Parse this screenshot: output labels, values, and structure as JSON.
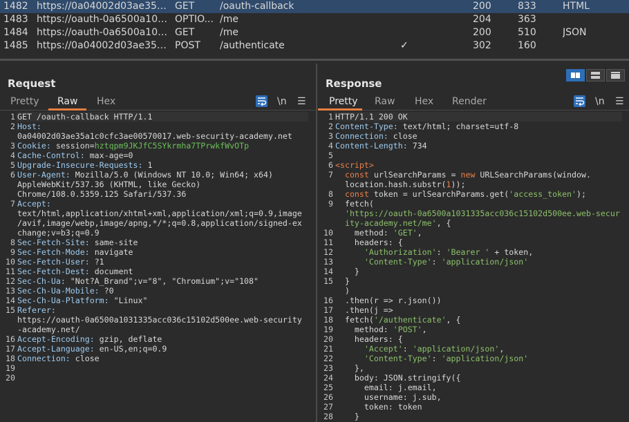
{
  "history": {
    "rows": [
      {
        "id": "1482",
        "host": "https://0a04002d03ae35a1c...",
        "method": "GET",
        "url": "/oauth-callback",
        "params": "",
        "status": "200",
        "length": "833",
        "mime": "HTML",
        "selected": true
      },
      {
        "id": "1483",
        "host": "https://oauth-0a6500a1031...",
        "method": "OPTIO...",
        "url": "/me",
        "params": "",
        "status": "204",
        "length": "363",
        "mime": "",
        "selected": false
      },
      {
        "id": "1484",
        "host": "https://oauth-0a6500a1031...",
        "method": "GET",
        "url": "/me",
        "params": "",
        "status": "200",
        "length": "510",
        "mime": "JSON",
        "selected": false
      },
      {
        "id": "1485",
        "host": "https://0a04002d03ae35a1c...",
        "method": "POST",
        "url": "/authenticate",
        "params": "✓",
        "status": "302",
        "length": "160",
        "mime": "",
        "selected": false
      }
    ]
  },
  "request": {
    "title": "Request",
    "tabs": [
      "Pretty",
      "Raw",
      "Hex"
    ],
    "active_tab": "Raw",
    "newline_label": "\\n",
    "lines": [
      {
        "n": "1",
        "segs": [
          {
            "t": "GET /oauth-callback HTTP/1.1",
            "c": ""
          }
        ]
      },
      {
        "n": "2",
        "segs": [
          {
            "t": "Host:",
            "c": "k"
          }
        ]
      },
      {
        "n": "",
        "segs": [
          {
            "t": "0a04002d03ae35a1c0cfc3ae00570017.web-security-academy.net",
            "c": ""
          }
        ]
      },
      {
        "n": "3",
        "segs": [
          {
            "t": "Cookie: ",
            "c": "k"
          },
          {
            "t": "session",
            "c": ""
          },
          {
            "t": "=",
            "c": ""
          },
          {
            "t": "hztqpm9JKJfC5SYkrmha7TPrwkfWvOTp",
            "c": "cookie"
          }
        ]
      },
      {
        "n": "4",
        "segs": [
          {
            "t": "Cache-Control: ",
            "c": "k"
          },
          {
            "t": "max-age=0",
            "c": ""
          }
        ]
      },
      {
        "n": "5",
        "segs": [
          {
            "t": "Upgrade-Insecure-Requests: ",
            "c": "k"
          },
          {
            "t": "1",
            "c": ""
          }
        ]
      },
      {
        "n": "6",
        "segs": [
          {
            "t": "User-Agent: ",
            "c": "k"
          },
          {
            "t": "Mozilla/5.0 (Windows NT 10.0; Win64; x64)",
            "c": ""
          }
        ]
      },
      {
        "n": "",
        "segs": [
          {
            "t": "AppleWebKit/537.36 (KHTML, like Gecko)",
            "c": ""
          }
        ]
      },
      {
        "n": "",
        "segs": [
          {
            "t": "Chrome/108.0.5359.125 Safari/537.36",
            "c": ""
          }
        ]
      },
      {
        "n": "7",
        "segs": [
          {
            "t": "Accept:",
            "c": "k"
          }
        ]
      },
      {
        "n": "",
        "segs": [
          {
            "t": "text/html,application/xhtml+xml,application/xml;q=0.9,image",
            "c": ""
          }
        ]
      },
      {
        "n": "",
        "segs": [
          {
            "t": "/avif,image/webp,image/apng,*/*;q=0.8,application/signed-ex",
            "c": ""
          }
        ]
      },
      {
        "n": "",
        "segs": [
          {
            "t": "change;v=b3;q=0.9",
            "c": ""
          }
        ]
      },
      {
        "n": "8",
        "segs": [
          {
            "t": "Sec-Fetch-Site: ",
            "c": "k"
          },
          {
            "t": "same-site",
            "c": ""
          }
        ]
      },
      {
        "n": "9",
        "segs": [
          {
            "t": "Sec-Fetch-Mode: ",
            "c": "k"
          },
          {
            "t": "navigate",
            "c": ""
          }
        ]
      },
      {
        "n": "10",
        "segs": [
          {
            "t": "Sec-Fetch-User: ",
            "c": "k"
          },
          {
            "t": "?1",
            "c": ""
          }
        ]
      },
      {
        "n": "11",
        "segs": [
          {
            "t": "Sec-Fetch-Dest: ",
            "c": "k"
          },
          {
            "t": "document",
            "c": ""
          }
        ]
      },
      {
        "n": "12",
        "segs": [
          {
            "t": "Sec-Ch-Ua: ",
            "c": "k"
          },
          {
            "t": "\"Not?A_Brand\";v=\"8\", \"Chromium\";v=\"108\"",
            "c": ""
          }
        ]
      },
      {
        "n": "13",
        "segs": [
          {
            "t": "Sec-Ch-Ua-Mobile: ",
            "c": "k"
          },
          {
            "t": "?0",
            "c": ""
          }
        ]
      },
      {
        "n": "14",
        "segs": [
          {
            "t": "Sec-Ch-Ua-Platform: ",
            "c": "k"
          },
          {
            "t": "\"Linux\"",
            "c": ""
          }
        ]
      },
      {
        "n": "15",
        "segs": [
          {
            "t": "Referer:",
            "c": "k"
          }
        ]
      },
      {
        "n": "",
        "segs": [
          {
            "t": "https://oauth-0a6500a1031335acc036c15102d500ee.web-security",
            "c": ""
          }
        ]
      },
      {
        "n": "",
        "segs": [
          {
            "t": "-academy.net/",
            "c": ""
          }
        ]
      },
      {
        "n": "16",
        "segs": [
          {
            "t": "Accept-Encoding: ",
            "c": "k"
          },
          {
            "t": "gzip, deflate",
            "c": ""
          }
        ]
      },
      {
        "n": "17",
        "segs": [
          {
            "t": "Accept-Language: ",
            "c": "k"
          },
          {
            "t": "en-US,en;q=0.9",
            "c": ""
          }
        ]
      },
      {
        "n": "18",
        "segs": [
          {
            "t": "Connection: ",
            "c": "k"
          },
          {
            "t": "close",
            "c": ""
          }
        ]
      },
      {
        "n": "19",
        "segs": []
      },
      {
        "n": "20",
        "segs": []
      }
    ]
  },
  "response": {
    "title": "Response",
    "tabs": [
      "Pretty",
      "Raw",
      "Hex",
      "Render"
    ],
    "active_tab": "Pretty",
    "newline_label": "\\n",
    "lines": [
      {
        "n": "1",
        "segs": [
          {
            "t": "HTTP/1.1 200 OK",
            "c": ""
          }
        ]
      },
      {
        "n": "2",
        "segs": [
          {
            "t": "Content-Type: ",
            "c": "k"
          },
          {
            "t": "text/html; charset=utf-8",
            "c": ""
          }
        ]
      },
      {
        "n": "3",
        "segs": [
          {
            "t": "Connection: ",
            "c": "k"
          },
          {
            "t": "close",
            "c": ""
          }
        ]
      },
      {
        "n": "4",
        "segs": [
          {
            "t": "Content-Length: ",
            "c": "k"
          },
          {
            "t": "734",
            "c": ""
          }
        ]
      },
      {
        "n": "5",
        "segs": []
      },
      {
        "n": "6",
        "segs": [
          {
            "t": "<script>",
            "c": "kw"
          }
        ]
      },
      {
        "n": "7",
        "segs": [
          {
            "t": "  const ",
            "c": "kw"
          },
          {
            "t": "urlSearchParams = ",
            "c": ""
          },
          {
            "t": "new ",
            "c": "kw"
          },
          {
            "t": "URLSearchParams(window.",
            "c": ""
          }
        ]
      },
      {
        "n": "",
        "segs": [
          {
            "t": "  location.hash.substr(",
            "c": ""
          },
          {
            "t": "1",
            "c": "kw"
          },
          {
            "t": "));",
            "c": ""
          }
        ]
      },
      {
        "n": "8",
        "segs": [
          {
            "t": "  const ",
            "c": "kw"
          },
          {
            "t": "token = urlSearchParams.get(",
            "c": ""
          },
          {
            "t": "'access_token'",
            "c": "str"
          },
          {
            "t": ");",
            "c": ""
          }
        ]
      },
      {
        "n": "9",
        "segs": [
          {
            "t": "  fetch(",
            "c": ""
          }
        ]
      },
      {
        "n": "",
        "segs": [
          {
            "t": "  'https://oauth-0a6500a1031335acc036c15102d500ee.web-secur",
            "c": "str"
          }
        ]
      },
      {
        "n": "",
        "segs": [
          {
            "t": "  ity-academy.net/me'",
            "c": "str"
          },
          {
            "t": ", {",
            "c": ""
          }
        ]
      },
      {
        "n": "10",
        "segs": [
          {
            "t": "    method: ",
            "c": ""
          },
          {
            "t": "'GET'",
            "c": "str"
          },
          {
            "t": ",",
            "c": ""
          }
        ]
      },
      {
        "n": "11",
        "segs": [
          {
            "t": "    headers: {",
            "c": ""
          }
        ]
      },
      {
        "n": "12",
        "segs": [
          {
            "t": "      ",
            "c": ""
          },
          {
            "t": "'Authorization'",
            "c": "str"
          },
          {
            "t": ": ",
            "c": ""
          },
          {
            "t": "'Bearer '",
            "c": "str"
          },
          {
            "t": " + token,",
            "c": ""
          }
        ]
      },
      {
        "n": "13",
        "segs": [
          {
            "t": "      ",
            "c": ""
          },
          {
            "t": "'Content-Type'",
            "c": "str"
          },
          {
            "t": ": ",
            "c": ""
          },
          {
            "t": "'application/json'",
            "c": "str"
          }
        ]
      },
      {
        "n": "14",
        "segs": [
          {
            "t": "    }",
            "c": ""
          }
        ]
      },
      {
        "n": "15",
        "segs": [
          {
            "t": "  }",
            "c": ""
          }
        ]
      },
      {
        "n": "",
        "segs": [
          {
            "t": "  )",
            "c": ""
          }
        ]
      },
      {
        "n": "16",
        "segs": [
          {
            "t": "  .then(r => r.json())",
            "c": ""
          }
        ]
      },
      {
        "n": "17",
        "segs": [
          {
            "t": "  .then(j =>",
            "c": ""
          }
        ]
      },
      {
        "n": "18",
        "segs": [
          {
            "t": "  fetch(",
            "c": ""
          },
          {
            "t": "'/authenticate'",
            "c": "str"
          },
          {
            "t": ", {",
            "c": ""
          }
        ]
      },
      {
        "n": "19",
        "segs": [
          {
            "t": "    method: ",
            "c": ""
          },
          {
            "t": "'POST'",
            "c": "str"
          },
          {
            "t": ",",
            "c": ""
          }
        ]
      },
      {
        "n": "20",
        "segs": [
          {
            "t": "    headers: {",
            "c": ""
          }
        ]
      },
      {
        "n": "21",
        "segs": [
          {
            "t": "      ",
            "c": ""
          },
          {
            "t": "'Accept'",
            "c": "str"
          },
          {
            "t": ": ",
            "c": ""
          },
          {
            "t": "'application/json'",
            "c": "str"
          },
          {
            "t": ",",
            "c": ""
          }
        ]
      },
      {
        "n": "22",
        "segs": [
          {
            "t": "      ",
            "c": ""
          },
          {
            "t": "'Content-Type'",
            "c": "str"
          },
          {
            "t": ": ",
            "c": ""
          },
          {
            "t": "'application/json'",
            "c": "str"
          }
        ]
      },
      {
        "n": "23",
        "segs": [
          {
            "t": "    },",
            "c": ""
          }
        ]
      },
      {
        "n": "24",
        "segs": [
          {
            "t": "    body: JSON.stringify({",
            "c": ""
          }
        ]
      },
      {
        "n": "25",
        "segs": [
          {
            "t": "      email: j.email,",
            "c": ""
          }
        ]
      },
      {
        "n": "26",
        "segs": [
          {
            "t": "      username: j.sub,",
            "c": ""
          }
        ]
      },
      {
        "n": "27",
        "segs": [
          {
            "t": "      token: token",
            "c": ""
          }
        ]
      },
      {
        "n": "28",
        "segs": [
          {
            "t": "    }",
            "c": ""
          }
        ]
      }
    ]
  }
}
